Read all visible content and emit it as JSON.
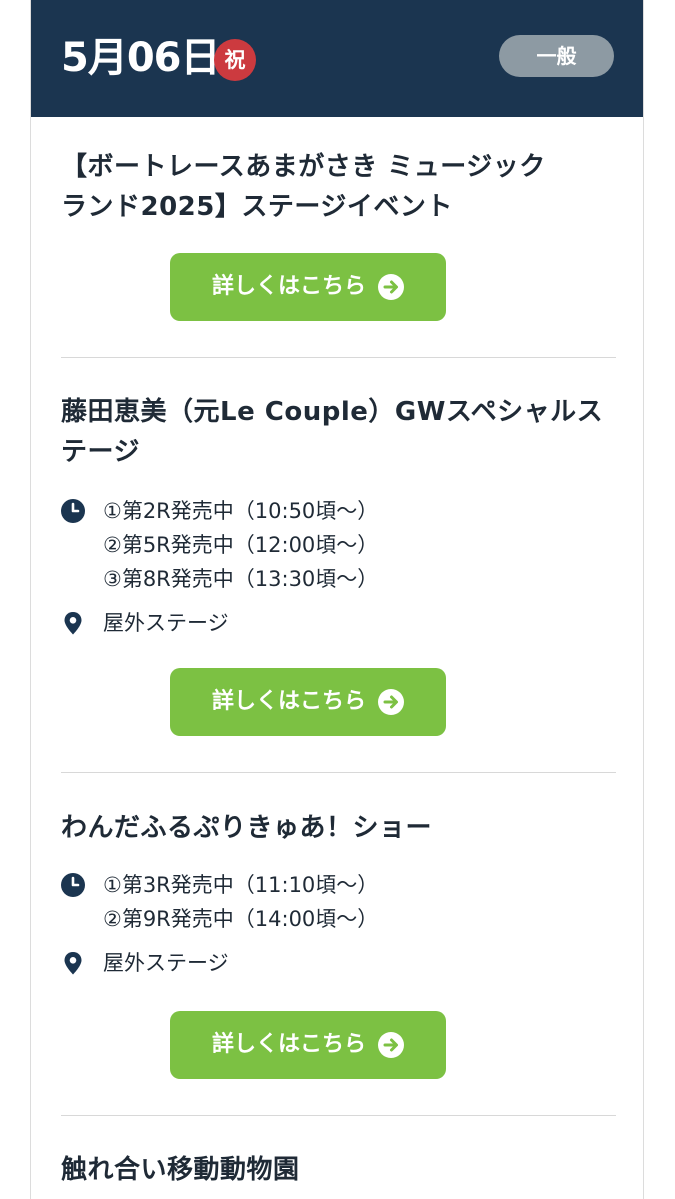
{
  "header": {
    "date": "5月06日",
    "holiday_badge": "祝",
    "category": "一般",
    "bg_color": "#1b3550"
  },
  "events": [
    {
      "title_lines": [
        "【ボートレースあまがさき ミュージック",
        "ランド2025】ステージイベント"
      ],
      "times": [],
      "location": "",
      "button_label": "詳しくはこちら"
    },
    {
      "title_lines": [
        "藤田恵美（元Le Couple）GWスペシャルス",
        "テージ"
      ],
      "times": [
        "①第2R発売中（10:50頃～）",
        "②第5R発売中（12:00頃～）",
        "③第8R発売中（13:30頃～）"
      ],
      "location": "屋外ステージ",
      "button_label": "詳しくはこちら"
    },
    {
      "title_lines": [
        "わんだふるぷりきゅあ！ショー"
      ],
      "times": [
        "①第3R発売中（11:10頃～）",
        "②第9R発売中（14:00頃～）"
      ],
      "location": "屋外ステージ",
      "button_label": "詳しくはこちら"
    },
    {
      "title_lines": [
        "触れ合い移動動物園"
      ],
      "times": [],
      "location": "",
      "button_label": ""
    }
  ],
  "icons": {
    "time": "clock-icon",
    "location": "map-pin-icon",
    "button_arrow": "arrow-right-circle-icon"
  },
  "colors": {
    "button": "#7cc143",
    "holiday": "#cc3a3f",
    "category": "#8d9aa3",
    "icon": "#1b3550"
  }
}
